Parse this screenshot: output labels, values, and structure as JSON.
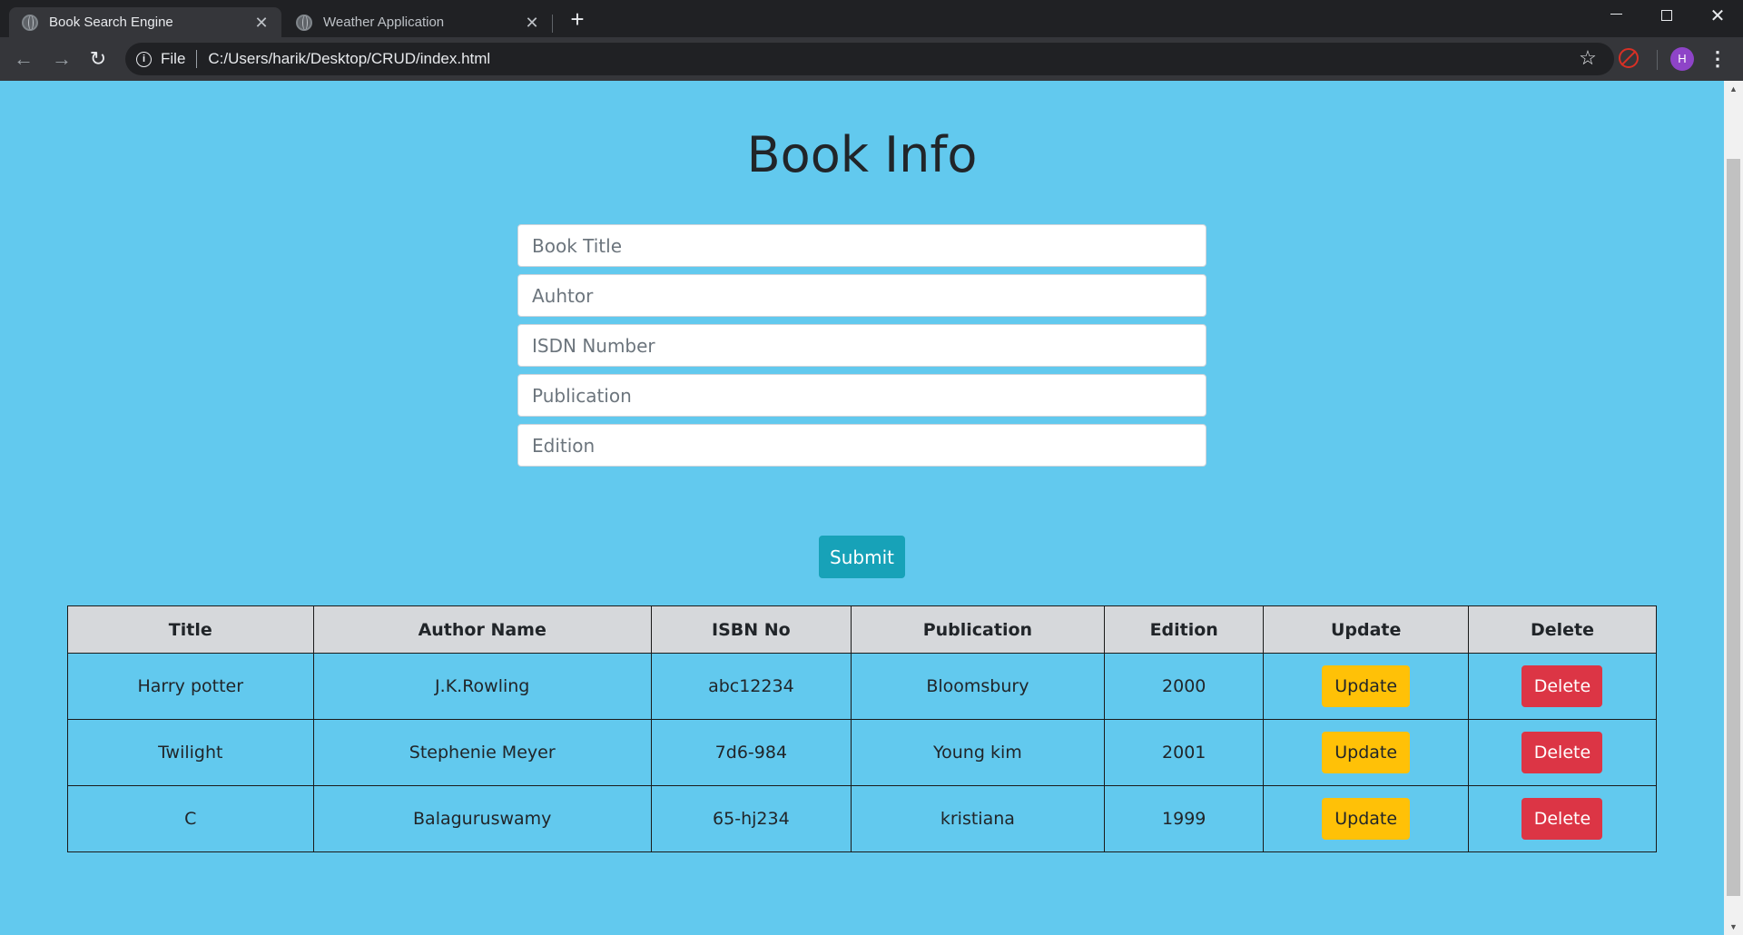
{
  "browser": {
    "tabs": [
      {
        "title": "Book Search Engine",
        "active": true
      },
      {
        "title": "Weather Application",
        "active": false
      }
    ],
    "address": {
      "scheme_label": "File",
      "url": "C:/Users/harik/Desktop/CRUD/index.html"
    },
    "profile_initial": "H"
  },
  "page": {
    "title": "Book Info",
    "form": {
      "title_placeholder": "Book Title",
      "author_placeholder": "Auhtor",
      "isbn_placeholder": "ISDN Number",
      "publication_placeholder": "Publication",
      "edition_placeholder": "Edition",
      "submit_label": "Submit"
    },
    "table": {
      "headers": [
        "Title",
        "Author Name",
        "ISBN No",
        "Publication",
        "Edition",
        "Update",
        "Delete"
      ],
      "rows": [
        {
          "title": "Harry potter",
          "author": "J.K.Rowling",
          "isbn": "abc12234",
          "publication": "Bloomsbury",
          "edition": "2000",
          "update_label": "Update",
          "delete_label": "Delete"
        },
        {
          "title": "Twilight",
          "author": "Stephenie Meyer",
          "isbn": "7d6-984",
          "publication": "Young kim",
          "edition": "2001",
          "update_label": "Update",
          "delete_label": "Delete"
        },
        {
          "title": "C",
          "author": "Balaguruswamy",
          "isbn": "65-hj234",
          "publication": "kristiana",
          "edition": "1999",
          "update_label": "Update",
          "delete_label": "Delete"
        }
      ]
    }
  },
  "colors": {
    "page_background": "#62c9ee",
    "submit": "#17a2b8",
    "update": "#ffc107",
    "delete": "#dc3545",
    "table_header": "#d6d8db"
  }
}
